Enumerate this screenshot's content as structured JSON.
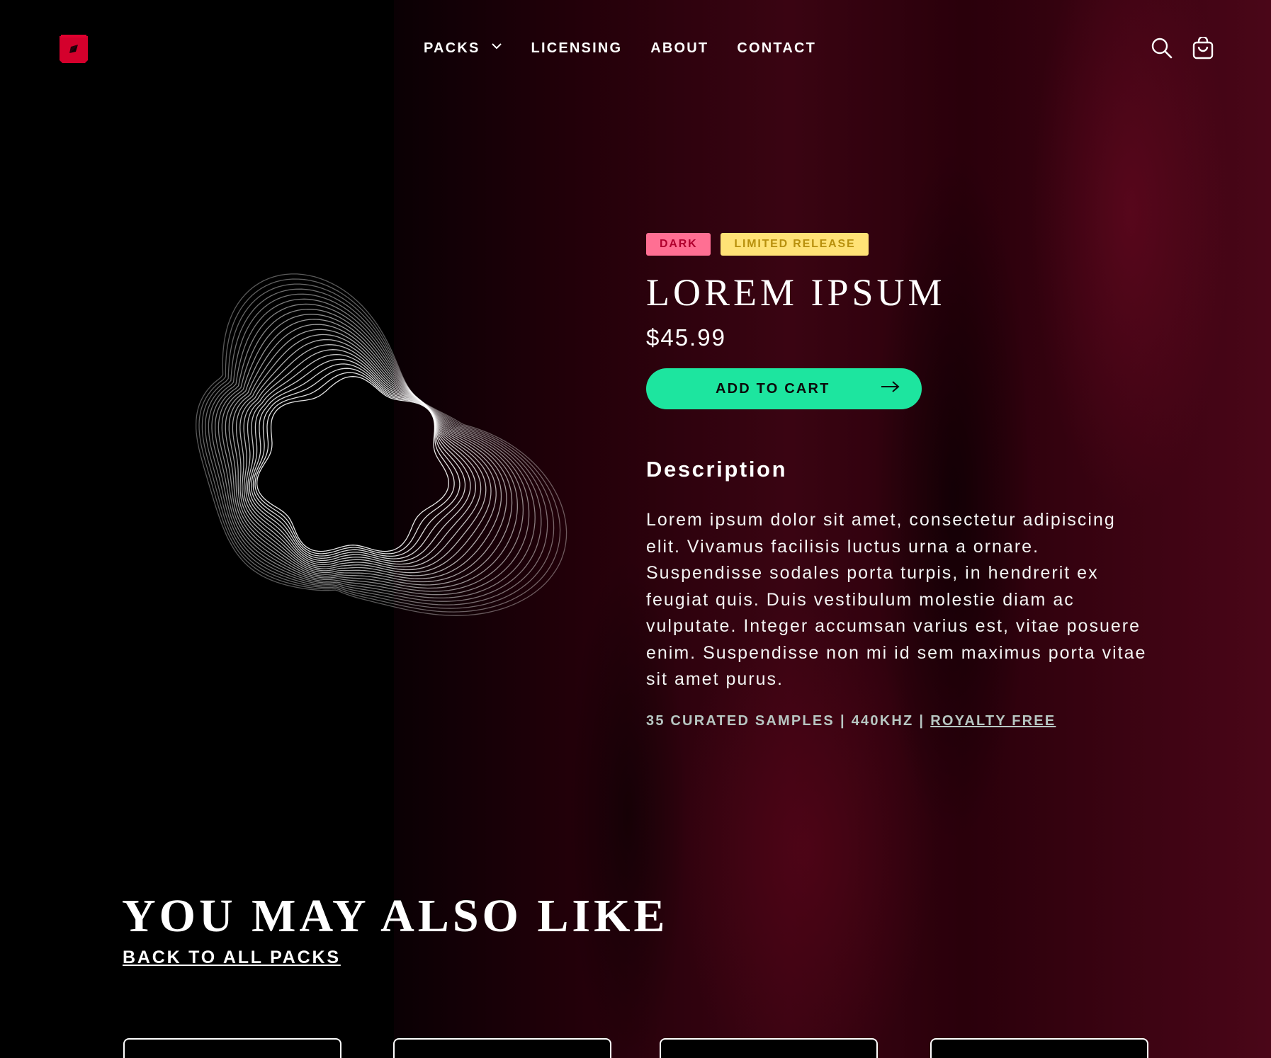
{
  "brand": {
    "logo_icon": "brand-logo-icon",
    "accent": "#d4002c"
  },
  "nav": {
    "items": [
      {
        "label": "PACKS",
        "has_dropdown": true
      },
      {
        "label": "LICENSING"
      },
      {
        "label": "ABOUT"
      },
      {
        "label": "CONTACT"
      }
    ]
  },
  "header_icons": [
    "search-icon",
    "shopping-bag-icon"
  ],
  "product": {
    "badges": [
      {
        "label": "DARK",
        "bg": "#ff6f93",
        "color": "#b0002e"
      },
      {
        "label": "LIMITED RELEASE",
        "bg": "#ffe276",
        "color": "#b8900d"
      }
    ],
    "title": "LOREM IPSUM",
    "price": "$45.99",
    "add_to_cart_label": "ADD TO CART",
    "add_to_cart_color": "#1de59f",
    "description_heading": "Description",
    "description": "Lorem ipsum dolor sit amet, consectetur adipiscing elit. Vivamus facilisis luctus urna a ornare. Suspendisse sodales porta turpis, in hendrerit ex feugiat quis. Duis vestibulum molestie diam ac vulputate. Integer accumsan varius est, vitae posuere enim. Suspendisse non mi id sem maximus porta vitae sit amet purus.",
    "meta": {
      "samples": "35 CURATED SAMPLES",
      "rate": "440KHZ",
      "license": "ROYALTY FREE"
    }
  },
  "related": {
    "heading": "YOU MAY ALSO LIKE",
    "back_link": "BACK TO ALL PACKS",
    "card_count": 4
  }
}
